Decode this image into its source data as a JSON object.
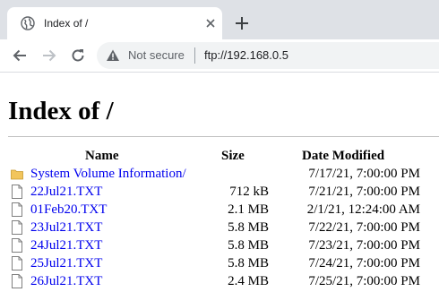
{
  "tab": {
    "title": "Index of /",
    "favicon": "globe-icon",
    "close_icon": "close-icon"
  },
  "toolbar": {
    "back_icon": "back-arrow-icon",
    "forward_icon": "forward-arrow-icon",
    "reload_icon": "reload-icon",
    "security_label": "Not secure",
    "url": "ftp://192.168.0.5"
  },
  "page": {
    "heading": "Index of /",
    "columns": {
      "name": "Name",
      "size": "Size",
      "date": "Date Modified"
    },
    "entries": [
      {
        "type": "folder",
        "name": "System Volume Information/",
        "size": "",
        "date": "7/17/21, 7:00:00 PM"
      },
      {
        "type": "file",
        "name": "22Jul21.TXT",
        "size": "712 kB",
        "date": "7/21/21, 7:00:00 PM"
      },
      {
        "type": "file",
        "name": "01Feb20.TXT",
        "size": "2.1 MB",
        "date": "2/1/21, 12:24:00 AM"
      },
      {
        "type": "file",
        "name": "23Jul21.TXT",
        "size": "5.8 MB",
        "date": "7/22/21, 7:00:00 PM"
      },
      {
        "type": "file",
        "name": "24Jul21.TXT",
        "size": "5.8 MB",
        "date": "7/23/21, 7:00:00 PM"
      },
      {
        "type": "file",
        "name": "25Jul21.TXT",
        "size": "5.8 MB",
        "date": "7/24/21, 7:00:00 PM"
      },
      {
        "type": "file",
        "name": "26Jul21.TXT",
        "size": "2.4 MB",
        "date": "7/25/21, 7:00:00 PM"
      }
    ]
  },
  "colors": {
    "link": "#0000ee",
    "tabstrip": "#dee1e6",
    "folder": "#f2c55c"
  }
}
